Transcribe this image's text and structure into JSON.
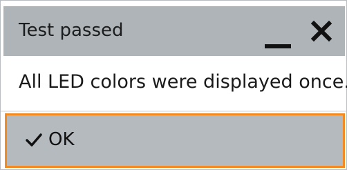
{
  "dialog": {
    "title": "Test passed",
    "message": "All LED colors were displayed once.",
    "ok_label": "OK"
  },
  "icons": {
    "minimize": "minimize-icon",
    "close": "close-icon",
    "check": "checkmark-icon"
  },
  "colors": {
    "titlebar": "#aeb4b8",
    "button_bg": "#b5babe",
    "focus_border": "#f18b22"
  }
}
